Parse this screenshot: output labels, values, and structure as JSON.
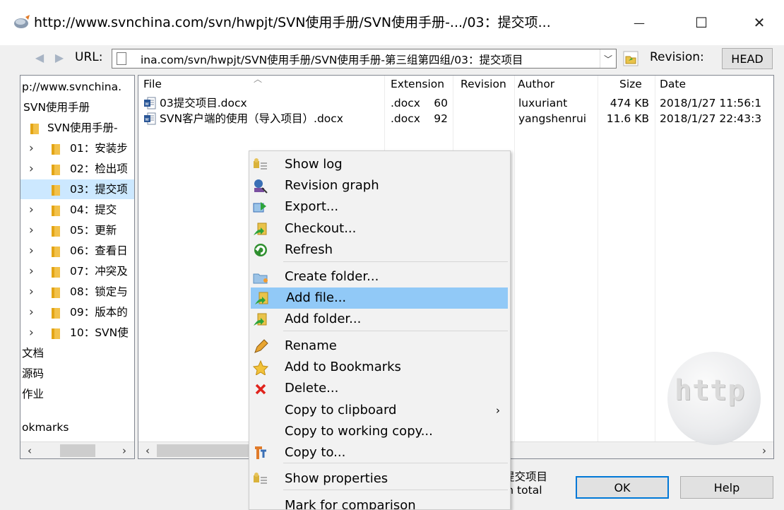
{
  "window": {
    "title": "http://www.svnchina.com/svn/hwpjt/SVN使用手册/SVN使用手册-.../03：提交项...",
    "icon": "repo-browser-icon",
    "minimize_glyph": "—",
    "maximize_glyph": "☐",
    "close_glyph": "✕"
  },
  "urlbar": {
    "label": "URL:",
    "value": "ina.com/svn/hwpjt/SVN使用手册/SVN使用手册-第三组第四组/03：提交项目",
    "revision_label": "Revision:",
    "revision_value": "HEAD"
  },
  "tree": {
    "rows": [
      {
        "label": "p://www.svnchina.",
        "selected": false
      },
      {
        "label": "SVN使用手册",
        "selected": false
      },
      {
        "label": "SVN使用手册-",
        "selected": false
      },
      {
        "label": "01：安装步",
        "selected": false
      },
      {
        "label": "02：检出项",
        "selected": false
      },
      {
        "label": "03：提交项",
        "selected": true
      },
      {
        "label": "04：提交",
        "selected": false
      },
      {
        "label": "05：更新",
        "selected": false
      },
      {
        "label": "06：查看日",
        "selected": false
      },
      {
        "label": "07：冲突及",
        "selected": false
      },
      {
        "label": "08：锁定与",
        "selected": false
      },
      {
        "label": "09：版本的",
        "selected": false
      },
      {
        "label": "10：SVN使",
        "selected": false
      },
      {
        "label": "文档",
        "selected": false
      },
      {
        "label": "源码",
        "selected": false
      },
      {
        "label": "作业",
        "selected": false
      }
    ],
    "bookmarks_label": "okmarks"
  },
  "filelist": {
    "columns": [
      "File",
      "Extension",
      "Revision",
      "Author",
      "Size",
      "Date"
    ],
    "rows": [
      {
        "file": "03提交项目.docx",
        "extension": ".docx",
        "revision": "60",
        "author": "luxuriant",
        "size": "474 KB",
        "date": "2018/1/27 11:56:1"
      },
      {
        "file": "SVN客户端的使用（导入项目）.docx",
        "extension": ".docx",
        "revision": "92",
        "author": "yangshenrui",
        "size": "11.6 KB",
        "date": "2018/1/27 22:43:3"
      }
    ]
  },
  "watermark_text": "http",
  "context_menu": {
    "items": [
      {
        "label": "Show log",
        "icon": "show-log-icon"
      },
      {
        "label": "Revision graph",
        "icon": "revision-graph-icon"
      },
      {
        "label": "Export...",
        "icon": "export-icon"
      },
      {
        "label": "Checkout...",
        "icon": "checkout-icon"
      },
      {
        "label": "Refresh",
        "icon": "refresh-icon"
      },
      {
        "label": "Create folder...",
        "icon": "create-folder-icon"
      },
      {
        "label": "Add file...",
        "icon": "add-file-icon",
        "highlighted": true
      },
      {
        "label": "Add folder...",
        "icon": "add-folder-icon"
      },
      {
        "label": "Rename",
        "icon": "rename-icon"
      },
      {
        "label": "Add to Bookmarks",
        "icon": "bookmark-star-icon"
      },
      {
        "label": "Delete...",
        "icon": "delete-icon"
      },
      {
        "label": "Copy to clipboard",
        "icon": "",
        "submenu_glyph": "›"
      },
      {
        "label": "Copy to working copy...",
        "icon": ""
      },
      {
        "label": "Copy to...",
        "icon": "copy-to-icon"
      },
      {
        "label": "Show properties",
        "icon": "show-properties-icon"
      },
      {
        "label": "Mark for comparison",
        "icon": ""
      }
    ]
  },
  "status": {
    "line1": "提交项目",
    "line2": "in total"
  },
  "buttons": {
    "ok": "OK",
    "help": "Help"
  }
}
